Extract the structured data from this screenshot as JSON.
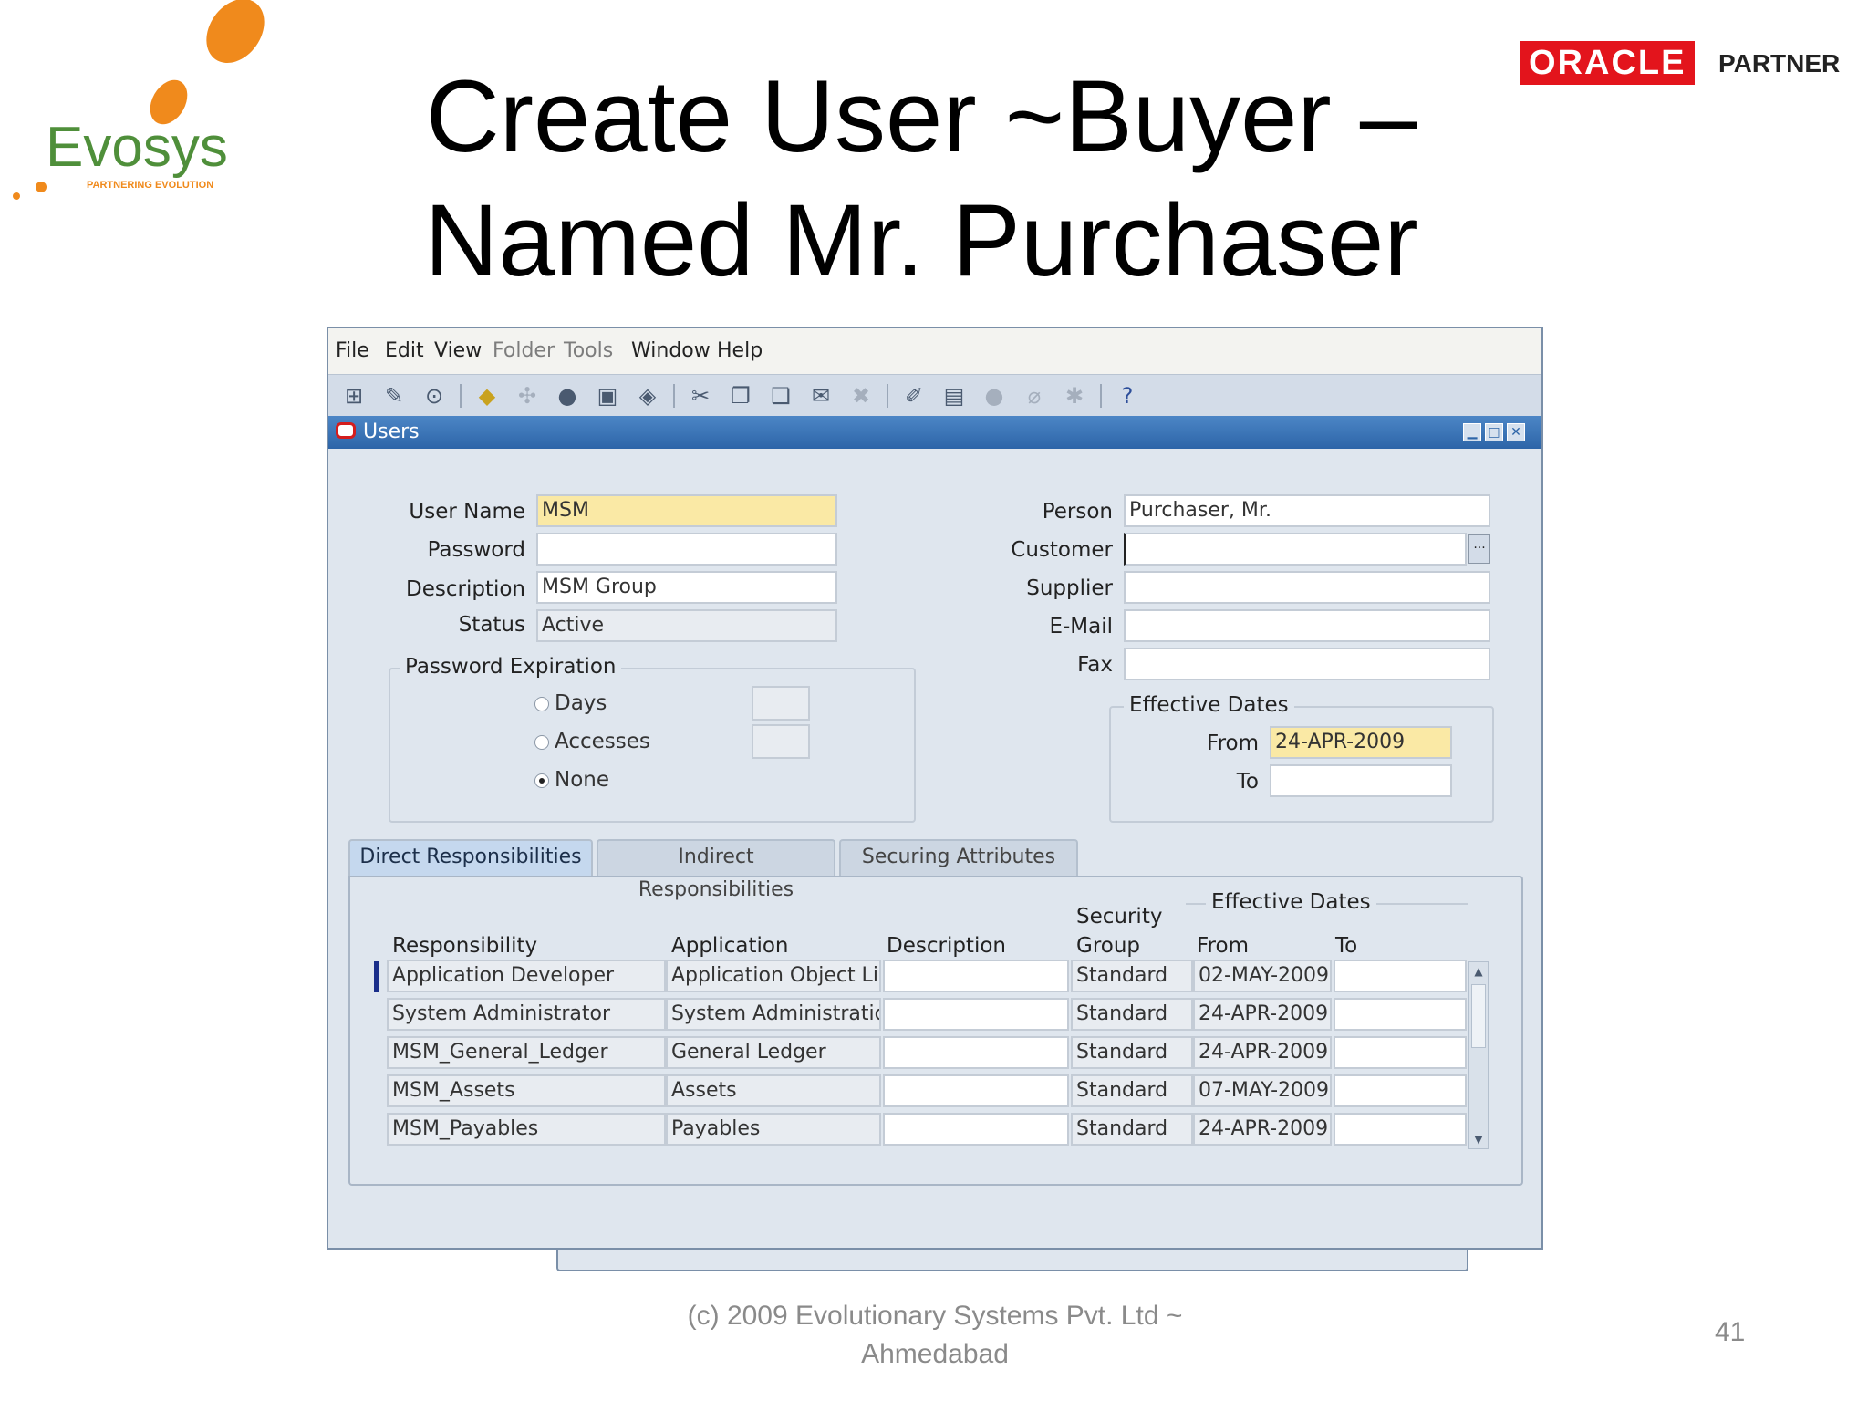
{
  "slide": {
    "title_line1": "Create User ~Buyer –",
    "title_line2": "Named Mr. Purchaser",
    "logo_text": "Evosys",
    "logo_tagline": "PARTNERING EVOLUTION",
    "oracle_logo": "ORACLE",
    "partner_label": "PARTNER",
    "footer_line1": "(c) 2009 Evolutionary Systems Pvt. Ltd ~",
    "footer_line2": "Ahmedabad",
    "page_number": "41"
  },
  "menu": [
    {
      "label": "File",
      "enabled": true
    },
    {
      "label": "Edit",
      "enabled": true
    },
    {
      "label": "View",
      "enabled": true
    },
    {
      "label": "Folder",
      "enabled": false
    },
    {
      "label": "Tools",
      "enabled": false
    },
    {
      "label": "Window",
      "enabled": true
    },
    {
      "label": "Help",
      "enabled": true
    }
  ],
  "toolbar_icons": [
    "new-record-icon",
    "find-icon",
    "navigator-icon",
    "save-icon",
    "next-step-icon",
    "switch-responsibility-icon",
    "print-icon",
    "close-form-icon",
    "cut-icon",
    "copy-icon",
    "paste-icon",
    "new-icon",
    "delete-record-icon",
    "edit-field-icon",
    "zoom-icon",
    "translations-icon",
    "attachments-icon",
    "folder-tools-icon",
    "help-icon"
  ],
  "window": {
    "title": "Users"
  },
  "form": {
    "user_name_label": "User Name",
    "user_name": "MSM",
    "password_label": "Password",
    "password": "",
    "description_label": "Description",
    "description": "MSM Group",
    "status_label": "Status",
    "status": "Active",
    "password_expiration": {
      "title": "Password Expiration",
      "days_label": "Days",
      "accesses_label": "Accesses",
      "none_label": "None",
      "selected": "None"
    },
    "person_label": "Person",
    "person": "Purchaser, Mr.",
    "customer_label": "Customer",
    "customer": "",
    "supplier_label": "Supplier",
    "supplier": "",
    "email_label": "E-Mail",
    "email": "",
    "fax_label": "Fax",
    "fax": "",
    "effective_dates": {
      "title": "Effective Dates",
      "from_label": "From",
      "from": "24-APR-2009",
      "to_label": "To",
      "to": ""
    }
  },
  "tabs": [
    {
      "label": "Direct Responsibilities",
      "active": true
    },
    {
      "label": "Indirect Responsibilities",
      "active": false
    },
    {
      "label": "Securing Attributes",
      "active": false
    }
  ],
  "responsibilities": {
    "headers": {
      "responsibility": "Responsibility",
      "application": "Application",
      "description": "Description",
      "security_group_line1": "Security",
      "security_group_line2": "Group",
      "effective_dates": "Effective Dates",
      "from": "From",
      "to": "To"
    },
    "rows": [
      {
        "responsibility": "Application Developer",
        "application": "Application Object Libı",
        "description": "",
        "security_group": "Standard",
        "from": "02-MAY-2009",
        "to": ""
      },
      {
        "responsibility": "System Administrator",
        "application": "System Administratior",
        "description": "",
        "security_group": "Standard",
        "from": "24-APR-2009",
        "to": ""
      },
      {
        "responsibility": "MSM_General_Ledger",
        "application": "General Ledger",
        "description": "",
        "security_group": "Standard",
        "from": "24-APR-2009",
        "to": ""
      },
      {
        "responsibility": "MSM_Assets",
        "application": "Assets",
        "description": "",
        "security_group": "Standard",
        "from": "07-MAY-2009",
        "to": ""
      },
      {
        "responsibility": "MSM_Payables",
        "application": "Payables",
        "description": "",
        "security_group": "Standard",
        "from": "24-APR-2009",
        "to": ""
      }
    ]
  },
  "colors": {
    "title_bar": "#2d65a8",
    "required_field": "#fae9a5",
    "oracle_red": "#e3141c",
    "evosys_orange": "#f08a1c",
    "evosys_green": "#4f8f3a"
  }
}
